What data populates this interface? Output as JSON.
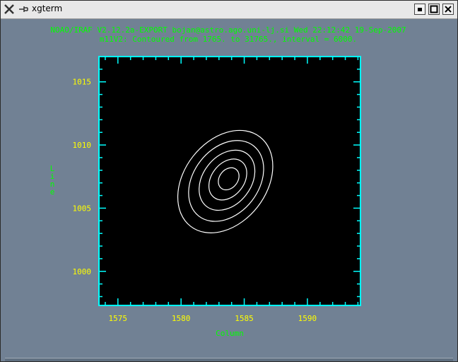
{
  "window": {
    "title": "xgterm",
    "icons": {
      "app": "x-logo-icon",
      "pin": "pin-icon"
    },
    "buttons": [
      "minimize-button",
      "maximize-button",
      "close-button"
    ]
  },
  "terminal": {
    "header_line1": "NOAO/IRAF V2.12.2a-EXPORT bojan@astro.ago.uni-lj.si Wed 22:12:42 19-Sep-2007",
    "header_line2": "m11V2: Contoured from 1765. to 31765., interval = 6000.",
    "text_color": "#00ff00",
    "background": "#718194"
  },
  "chart_data": {
    "type": "contour",
    "xlabel": "Column",
    "ylabel": "Line",
    "xlim": [
      1573.5,
      1594.2
    ],
    "ylim": [
      997.3,
      1017.0
    ],
    "x_ticks": [
      "1575",
      "1580",
      "1585",
      "1590"
    ],
    "y_ticks": [
      "1000",
      "1005",
      "1010",
      "1015"
    ],
    "contour_levels": [
      1765,
      7765,
      13765,
      19765,
      25765,
      31765
    ],
    "center": {
      "x": 1583.5,
      "y": 1007.1
    },
    "colors": {
      "frame": "#00ffff",
      "contours": "#ffffff",
      "ticklabels": "#ffff00",
      "axislabels": "#00ff00",
      "plot_bg": "#000000"
    }
  }
}
